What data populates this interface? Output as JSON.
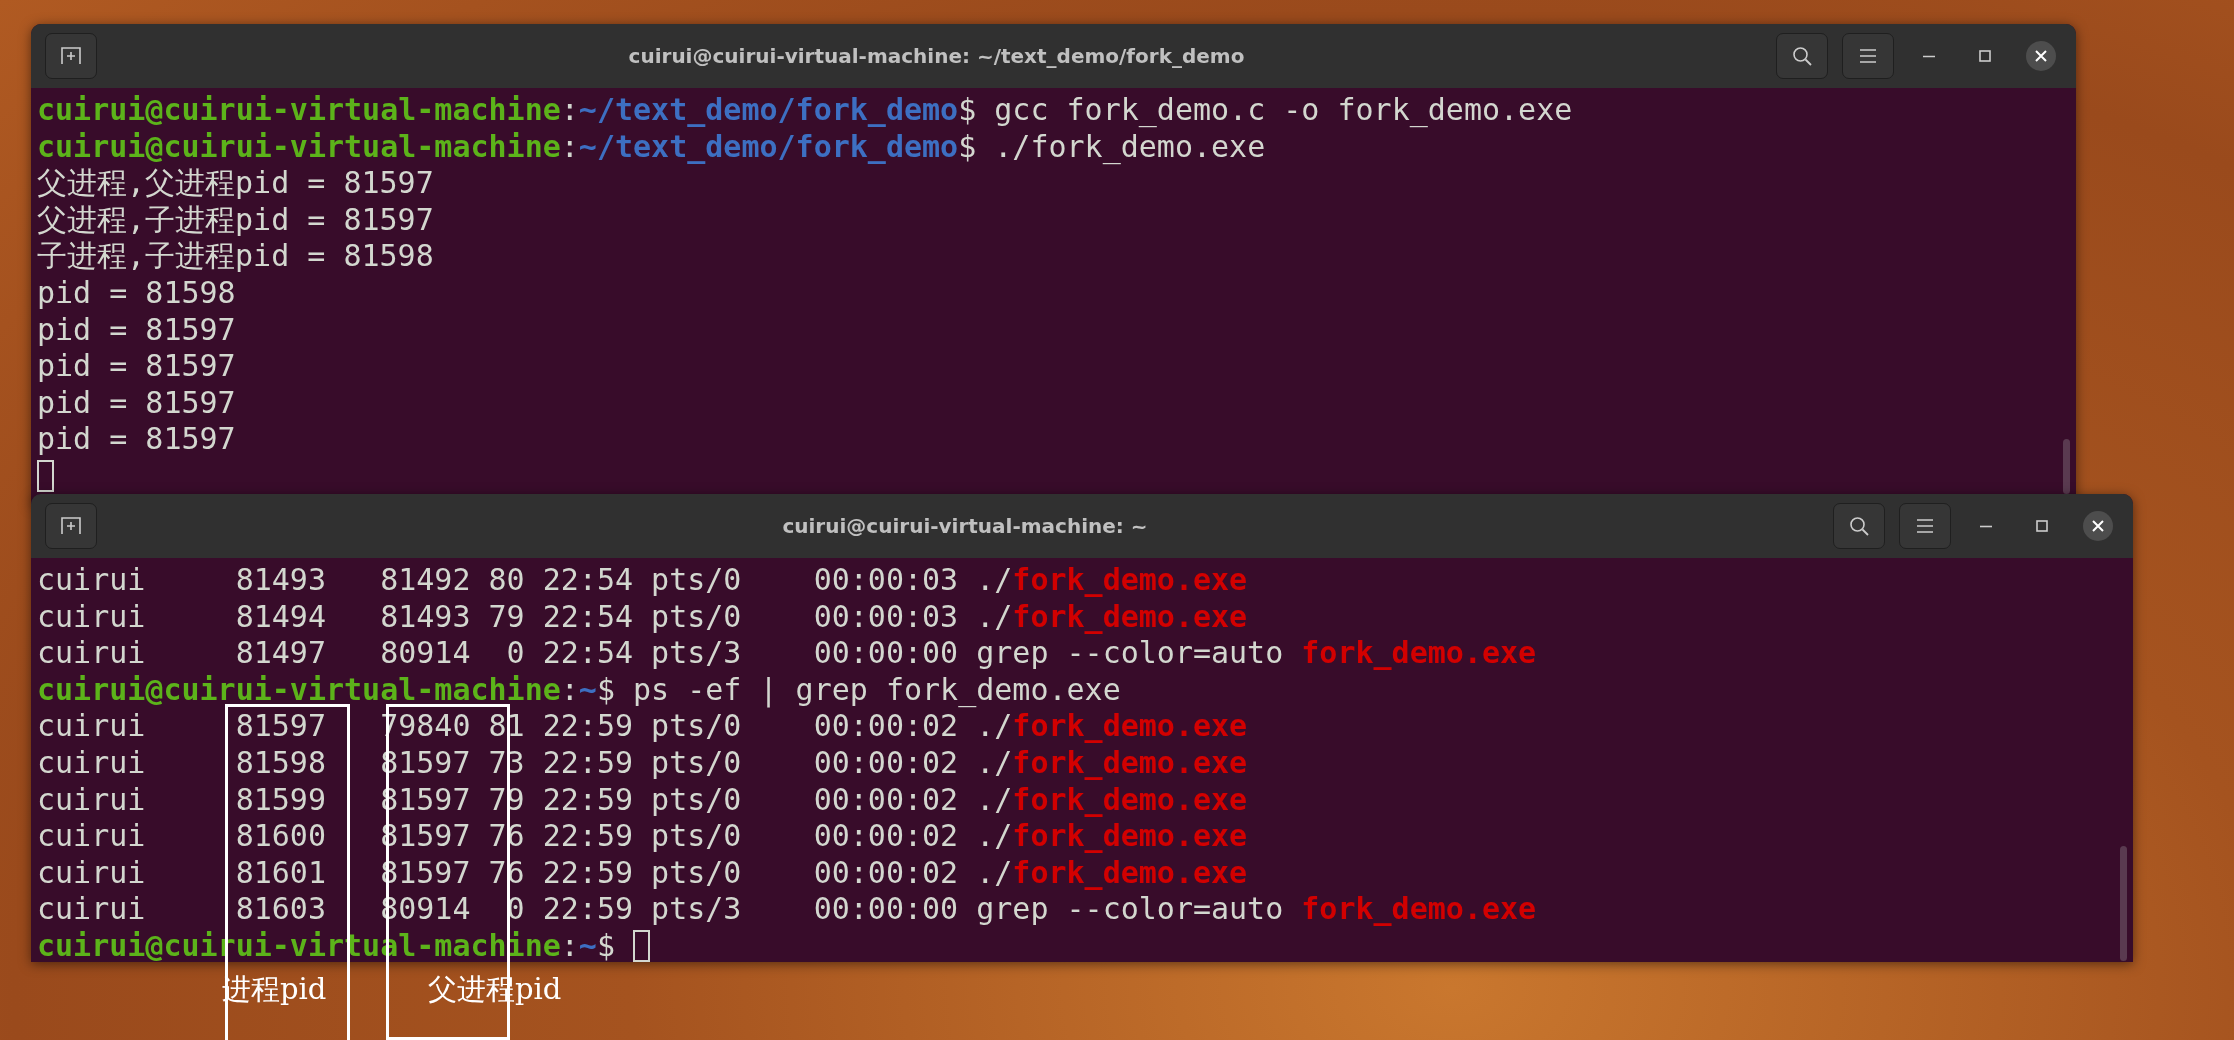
{
  "windows": [
    {
      "title": "cuirui@cuirui-virtual-machine: ~/text_demo/fork_demo",
      "lines": [
        {
          "segments": [
            {
              "kind": "user",
              "text": "cuirui@cuirui-virtual-machine"
            },
            {
              "kind": "plain",
              "text": ":"
            },
            {
              "kind": "path",
              "text": "~/text_demo/fork_demo"
            },
            {
              "kind": "plain",
              "text": "$ gcc fork_demo.c -o fork_demo.exe"
            }
          ]
        },
        {
          "segments": [
            {
              "kind": "user",
              "text": "cuirui@cuirui-virtual-machine"
            },
            {
              "kind": "plain",
              "text": ":"
            },
            {
              "kind": "path",
              "text": "~/text_demo/fork_demo"
            },
            {
              "kind": "plain",
              "text": "$ ./fork_demo.exe"
            }
          ]
        },
        {
          "segments": [
            {
              "kind": "plain",
              "text": "父进程,父进程pid = 81597"
            }
          ]
        },
        {
          "segments": [
            {
              "kind": "plain",
              "text": "父进程,子进程pid = 81597"
            }
          ]
        },
        {
          "segments": [
            {
              "kind": "plain",
              "text": "子进程,子进程pid = 81598"
            }
          ]
        },
        {
          "segments": [
            {
              "kind": "plain",
              "text": "pid = 81598"
            }
          ]
        },
        {
          "segments": [
            {
              "kind": "plain",
              "text": "pid = 81597"
            }
          ]
        },
        {
          "segments": [
            {
              "kind": "plain",
              "text": "pid = 81597"
            }
          ]
        },
        {
          "segments": [
            {
              "kind": "plain",
              "text": "pid = 81597"
            }
          ]
        },
        {
          "segments": [
            {
              "kind": "plain",
              "text": "pid = 81597"
            }
          ]
        },
        {
          "cursor": true
        }
      ]
    },
    {
      "title": "cuirui@cuirui-virtual-machine: ~",
      "lines": [
        {
          "segments": [
            {
              "kind": "plain",
              "text": "cuirui     81493   81492 80 22:54 pts/0    00:00:03 ./"
            },
            {
              "kind": "match",
              "text": "fork_demo.exe"
            }
          ]
        },
        {
          "segments": [
            {
              "kind": "plain",
              "text": "cuirui     81494   81493 79 22:54 pts/0    00:00:03 ./"
            },
            {
              "kind": "match",
              "text": "fork_demo.exe"
            }
          ]
        },
        {
          "segments": [
            {
              "kind": "plain",
              "text": "cuirui     81497   80914  0 22:54 pts/3    00:00:00 grep --color=auto "
            },
            {
              "kind": "match",
              "text": "fork_demo.exe"
            }
          ]
        },
        {
          "segments": [
            {
              "kind": "user",
              "text": "cuirui@cuirui-virtual-machine"
            },
            {
              "kind": "plain",
              "text": ":"
            },
            {
              "kind": "path",
              "text": "~"
            },
            {
              "kind": "plain",
              "text": "$ ps -ef | grep fork_demo.exe"
            }
          ]
        },
        {
          "segments": [
            {
              "kind": "plain",
              "text": "cuirui     81597   79840 81 22:59 pts/0    00:00:02 ./"
            },
            {
              "kind": "match",
              "text": "fork_demo.exe"
            }
          ]
        },
        {
          "segments": [
            {
              "kind": "plain",
              "text": "cuirui     81598   81597 73 22:59 pts/0    00:00:02 ./"
            },
            {
              "kind": "match",
              "text": "fork_demo.exe"
            }
          ]
        },
        {
          "segments": [
            {
              "kind": "plain",
              "text": "cuirui     81599   81597 79 22:59 pts/0    00:00:02 ./"
            },
            {
              "kind": "match",
              "text": "fork_demo.exe"
            }
          ]
        },
        {
          "segments": [
            {
              "kind": "plain",
              "text": "cuirui     81600   81597 76 22:59 pts/0    00:00:02 ./"
            },
            {
              "kind": "match",
              "text": "fork_demo.exe"
            }
          ]
        },
        {
          "segments": [
            {
              "kind": "plain",
              "text": "cuirui     81601   81597 76 22:59 pts/0    00:00:02 ./"
            },
            {
              "kind": "match",
              "text": "fork_demo.exe"
            }
          ]
        },
        {
          "segments": [
            {
              "kind": "plain",
              "text": "cuirui     81603   80914  0 22:59 pts/3    00:00:00 grep --color=auto "
            },
            {
              "kind": "match",
              "text": "fork_demo.exe"
            }
          ]
        },
        {
          "segments": [
            {
              "kind": "user",
              "text": "cuirui@cuirui-virtual-machine"
            },
            {
              "kind": "plain",
              "text": ":"
            },
            {
              "kind": "path",
              "text": "~"
            },
            {
              "kind": "plain",
              "text": "$ "
            }
          ],
          "cursor": true
        }
      ]
    }
  ],
  "annotations": [
    {
      "label": "进程pid"
    },
    {
      "label": "父进程pid"
    }
  ]
}
